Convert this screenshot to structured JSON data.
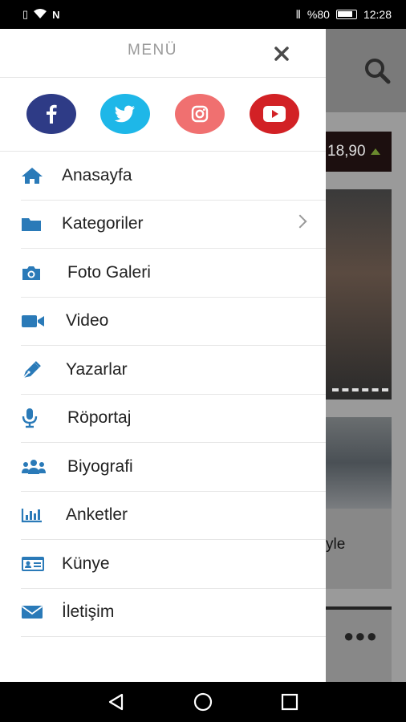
{
  "status_bar": {
    "left_icons": [
      "sim-icon",
      "wifi-icon",
      "nfc-icon"
    ],
    "right_icons": [
      "vibrate-icon"
    ],
    "battery": "%80",
    "time": "12:28"
  },
  "background": {
    "ticker_value": "18,90",
    "partial_text": "yle"
  },
  "drawer": {
    "title": "MENÜ",
    "close_label": "✕",
    "social": [
      {
        "name": "facebook",
        "color": "#2e3b86"
      },
      {
        "name": "twitter",
        "color": "#1eb7e8"
      },
      {
        "name": "instagram",
        "color": "#f07070"
      },
      {
        "name": "youtube",
        "color": "#d22125"
      }
    ],
    "items": [
      {
        "label": "Anasayfa",
        "icon": "home-icon"
      },
      {
        "label": "Kategoriler",
        "icon": "folder-icon"
      },
      {
        "label": "Foto Galeri",
        "icon": "camera-icon"
      },
      {
        "label": "Video",
        "icon": "video-camera-icon"
      },
      {
        "label": "Yazarlar",
        "icon": "pen-icon"
      },
      {
        "label": "Röportaj",
        "icon": "microphone-icon"
      },
      {
        "label": "Biyografi",
        "icon": "users-icon"
      },
      {
        "label": "Anketler",
        "icon": "bar-chart-icon"
      },
      {
        "label": "Künye",
        "icon": "id-card-icon"
      },
      {
        "label": "İletişim",
        "icon": "envelope-icon"
      }
    ]
  },
  "colors": {
    "icon_blue": "#2a7ab8",
    "text": "#222222",
    "menu_title": "#9a9a9a"
  }
}
